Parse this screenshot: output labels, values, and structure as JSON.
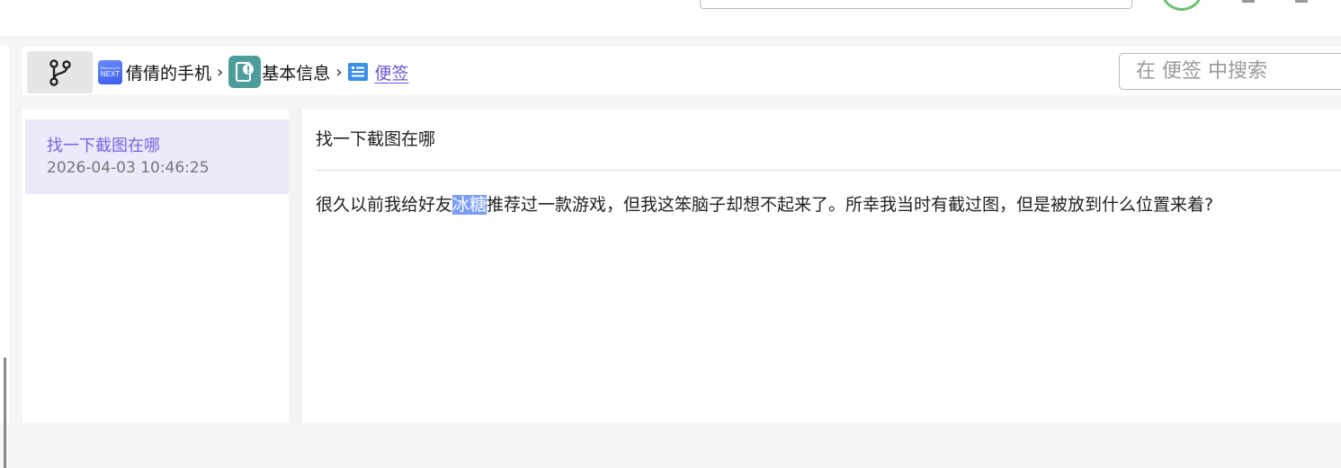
{
  "breadcrumb": {
    "device_name": "倩倩的手机",
    "device_logo_text": "NEXT",
    "device_logo_small": "HarmonyOS",
    "section_name": "基本信息",
    "current_page": "便签"
  },
  "search": {
    "placeholder": "在 便签 中搜索"
  },
  "notes_list": [
    {
      "title": "找一下截图在哪",
      "date": "2026-04-03 10:46:25",
      "selected": true
    }
  ],
  "note": {
    "title": "找一下截图在哪",
    "body_before": "很久以前我给好友",
    "body_selected": "冰糖",
    "body_after": "推荐过一款游戏，但我这笨脑子却想不起来了。所幸我当时有截过图，但是被放到什么位置来着?"
  },
  "colors": {
    "accent": "#6a54d8",
    "selected_item_bg": "#ece9fb",
    "text_selection": "#7a9df4"
  },
  "icons": {
    "branch": "branch-icon",
    "phone_logo": "harmony-next-logo",
    "info": "info-card-icon",
    "note": "note-list-icon"
  }
}
